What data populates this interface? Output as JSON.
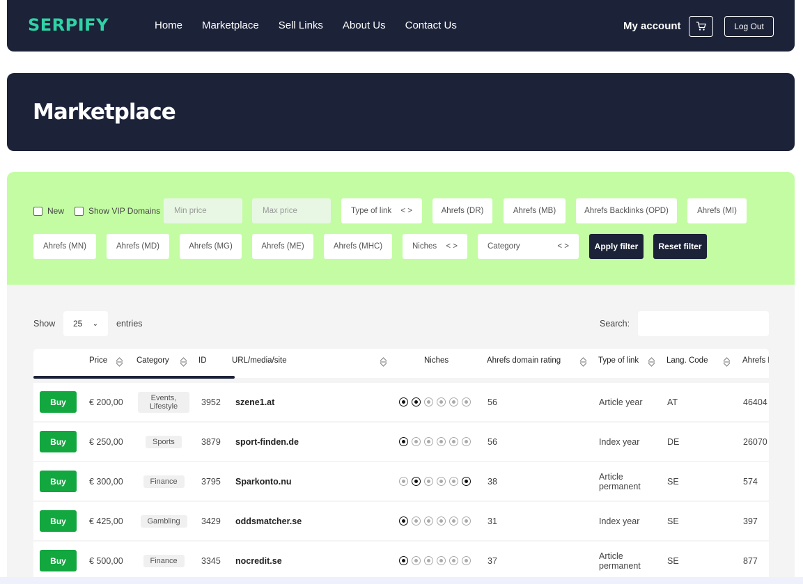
{
  "header": {
    "logo": "SERPIFY",
    "nav": [
      "Home",
      "Marketplace",
      "Sell Links",
      "About Us",
      "Contact Us"
    ],
    "account": "My account",
    "logout": "Log Out"
  },
  "hero": {
    "title": "Marketplace"
  },
  "filters": {
    "new_label": "New",
    "vip_label": "Show VIP Domains",
    "min_price_placeholder": "Min price",
    "max_price_placeholder": "Max price",
    "type_of_link": "Type of link",
    "ahrefs_dr": "Ahrefs (DR)",
    "ahrefs_mb": "Ahrefs (MB)",
    "ahrefs_opd": "Ahrefs Backlinks (OPD)",
    "ahrefs_mi": "Ahrefs (MI)",
    "ahrefs_mn": "Ahrefs (MN)",
    "ahrefs_md": "Ahrefs (MD)",
    "ahrefs_mg": "Ahrefs (MG)",
    "ahrefs_me": "Ahrefs (ME)",
    "ahrefs_mhc": "Ahrefs (MHC)",
    "niches": "Niches",
    "category": "Category",
    "apply": "Apply filter",
    "reset": "Reset filter"
  },
  "table_controls": {
    "show": "Show",
    "entries_value": "25",
    "entries": "entries",
    "search": "Search:"
  },
  "columns": [
    "Price",
    "Category",
    "ID",
    "URL/media/site",
    "Niches",
    "Ahrefs domain rating",
    "Type of link",
    "Lang. Code",
    "Ahrefs M"
  ],
  "buy_label": "Buy",
  "rows": [
    {
      "price": "€ 200,00",
      "category": "Events, Lifestyle",
      "id": "3952",
      "url": "szene1.at",
      "dr": "56",
      "type": "Article year",
      "lang": "AT",
      "ahrefs": "46404",
      "niches": [
        1,
        1,
        0,
        0,
        0,
        0
      ]
    },
    {
      "price": "€ 250,00",
      "category": "Sports",
      "id": "3879",
      "url": "sport-finden.de",
      "dr": "56",
      "type": "Index year",
      "lang": "DE",
      "ahrefs": "26070",
      "niches": [
        1,
        0,
        0,
        0,
        0,
        0
      ]
    },
    {
      "price": "€ 300,00",
      "category": "Finance",
      "id": "3795",
      "url": "Sparkonto.nu",
      "dr": "38",
      "type": "Article permanent",
      "lang": "SE",
      "ahrefs": "574",
      "niches": [
        0,
        1,
        0,
        0,
        0,
        1
      ]
    },
    {
      "price": "€ 425,00",
      "category": "Gambling",
      "id": "3429",
      "url": "oddsmatcher.se",
      "dr": "31",
      "type": "Index year",
      "lang": "SE",
      "ahrefs": "397",
      "niches": [
        1,
        0,
        0,
        0,
        0,
        0
      ]
    },
    {
      "price": "€ 500,00",
      "category": "Finance",
      "id": "3345",
      "url": "nocredit.se",
      "dr": "37",
      "type": "Article permanent",
      "lang": "SE",
      "ahrefs": "877",
      "niches": [
        1,
        0,
        0,
        0,
        0,
        0
      ]
    }
  ]
}
